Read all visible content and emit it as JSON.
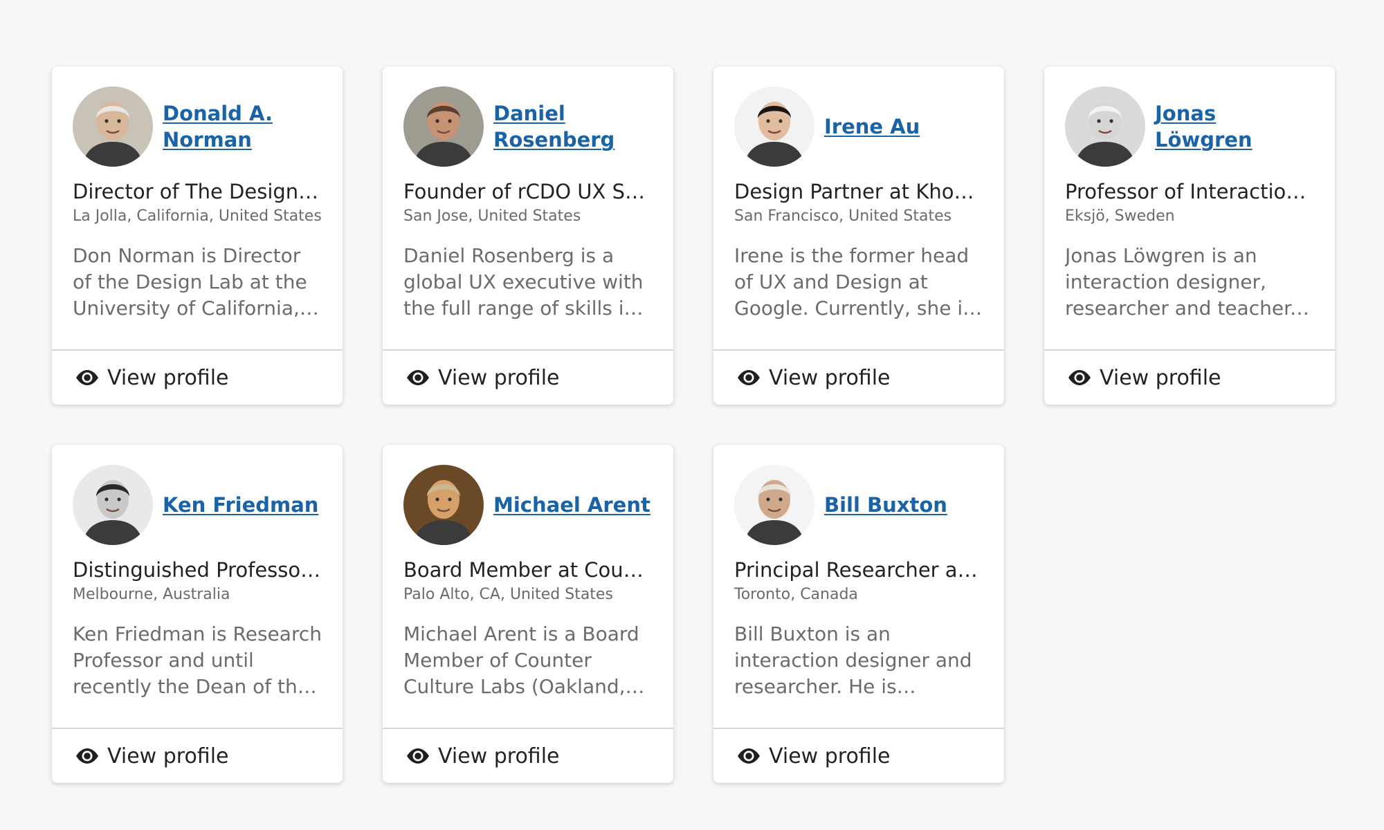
{
  "view_label": "View profile",
  "view_icon": "eye-icon",
  "colors": {
    "link": "#1a63a6",
    "background": "#f7f7f7",
    "card": "#ffffff"
  },
  "cards": [
    {
      "name": "Donald A. Norman",
      "title": "Director of The Design Lab",
      "location": "La Jolla, California, United States",
      "bio": "Don Norman is Director of the Design Lab at the University of California, San Diego",
      "avatar_bg": "#c9c2b6",
      "avatar_face": "#d9b79a",
      "avatar_hair": "#e8e6e2"
    },
    {
      "name": "Daniel Rosenberg",
      "title": "Founder of rCDO UX Strategy",
      "location": "San Jose, United States",
      "bio": "Daniel Rosenberg is a global UX executive with the full range of skills in design and strategy",
      "avatar_bg": "#9e9c90",
      "avatar_face": "#c89274",
      "avatar_hair": "#5a4030"
    },
    {
      "name": "Irene Au",
      "title": "Design Partner at Khosla Ventures",
      "location": "San Francisco, United States",
      "bio": "Irene is the former head of UX and Design at Google. Currently, she is an operating partner",
      "avatar_bg": "#f2f2f2",
      "avatar_face": "#e1bc9f",
      "avatar_hair": "#1b1512"
    },
    {
      "name": "Jonas Löwgren",
      "title": "Professor of Interaction Design",
      "location": "Eksjö, Sweden",
      "bio": "Jonas Löwgren is an interaction designer, researcher and teacher. He is a professor",
      "avatar_bg": "#dadada",
      "avatar_face": "#d6d6d6",
      "avatar_hair": "#f2f2f2"
    },
    {
      "name": "Ken Friedman",
      "title": "Distinguished Professor of Design",
      "location": "Melbourne, Australia",
      "bio": "Ken Friedman is Research Professor and until recently the Dean of the Faculty of Design",
      "avatar_bg": "#e9e9e9",
      "avatar_face": "#c9c9c9",
      "avatar_hair": "#2a2a2a"
    },
    {
      "name": "Michael Arent",
      "title": "Board Member at Counter Culture Labs",
      "location": "Palo Alto, CA, United States",
      "bio": "Michael Arent is a Board Member of Counter Culture Labs (Oakland, CA)",
      "avatar_bg": "#6a4a26",
      "avatar_face": "#d6a06a",
      "avatar_hair": "#c9b98f"
    },
    {
      "name": "Bill Buxton",
      "title": "Principal Researcher at Microsoft Research",
      "location": "Toronto, Canada",
      "bio": "Bill Buxton is an interaction designer and researcher. He is Principal Researcher at Microsoft",
      "avatar_bg": "#f4f4f4",
      "avatar_face": "#cfa98c",
      "avatar_hair": "#e8e4dc"
    }
  ]
}
